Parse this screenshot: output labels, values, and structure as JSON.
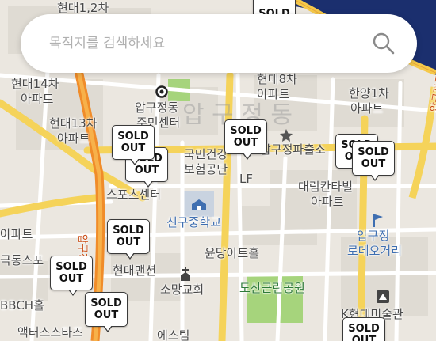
{
  "search": {
    "placeholder": "목적지를 검색하세요",
    "value": "",
    "icon": "search-icon"
  },
  "map": {
    "labels": {
      "hyundai12": "현대1,2차",
      "hyundai14_a": "현대14차",
      "hyundai14_b": "아파트",
      "hyundai13_a": "현대13차",
      "hyundai13_b": "아파트",
      "hyundai8_a": "현대8차",
      "hyundai8_b": "아파트",
      "hanyang1_a": "한양1차",
      "hanyang1_b": "아파트",
      "center_a": "압구정동",
      "center_b": "주민센터",
      "district": "압 구 정 동",
      "police": "압구정파출소",
      "nhis_a": "국민건강",
      "nhis_b": "보험공단",
      "lf": "LF",
      "sports": "스포츠센터",
      "daelim_a": "대림칸타빌",
      "daelim_b": "아파트",
      "school": "신구중학교",
      "rodeo_a": "압구정",
      "rodeo_b": "로데오거리",
      "apt_left": "아파트",
      "gukdong": "극동스포",
      "yundang": "윤당아트홀",
      "mansion": "현대맨션",
      "church": "소망교회",
      "dosan": "도산근린공원",
      "bbch": "BBCH홀",
      "kmuseum": "K현대미술관",
      "actors": "액터스스타즈",
      "esteem": "에스팀",
      "road_apgujeong": "압구정로",
      "road_apgujeongro": "압구정로"
    },
    "markers": [
      {
        "text": "SOLD"
      },
      {
        "text": "SOLD OUT"
      },
      {
        "text": "SOLD OUT"
      },
      {
        "text": "SOLD OUT"
      },
      {
        "text": "SOLD OUT"
      },
      {
        "text": "SOLD OUT"
      },
      {
        "text": "SOLD OUT"
      },
      {
        "text": "SOLD OUT"
      },
      {
        "text": "SOLD OUT"
      },
      {
        "text": "SOLD OUT"
      }
    ],
    "colors": {
      "river": "#1b2f6e",
      "park": "#a6d47c",
      "major_road": "#f5c94a",
      "arterial": "#f0a03c",
      "block": "#e2ded6"
    }
  }
}
